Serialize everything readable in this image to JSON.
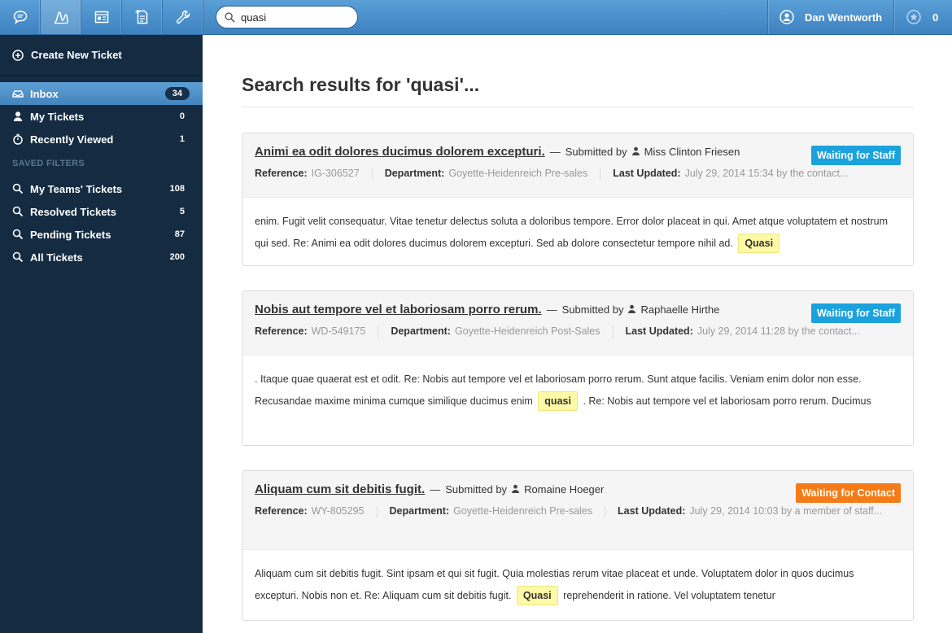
{
  "topbar": {
    "nav_icons": [
      "chat-icon",
      "stats-icon",
      "tickets-icon",
      "new-document-icon",
      "wrench-icon"
    ],
    "search_value": "quasi",
    "user_name": "Dan Wentworth",
    "star_count": "0"
  },
  "sidebar": {
    "create_label": "Create New Ticket",
    "items": [
      {
        "label": "Inbox",
        "count": "34",
        "icon": "inbox-icon"
      },
      {
        "label": "My Tickets",
        "count": "0",
        "icon": "user-icon"
      },
      {
        "label": "Recently Viewed",
        "count": "1",
        "icon": "stopwatch-icon"
      }
    ],
    "saved_filters_heading": "SAVED FILTERS",
    "filters": [
      {
        "label": "My Teams' Tickets",
        "count": "108"
      },
      {
        "label": "Resolved Tickets",
        "count": "5"
      },
      {
        "label": "Pending Tickets",
        "count": "87"
      },
      {
        "label": "All Tickets",
        "count": "200"
      }
    ]
  },
  "main": {
    "title": "Search results for 'quasi'...",
    "results": [
      {
        "title": "Animi ea odit dolores ducimus dolorem excepturi.",
        "submitted_by_label": "Submitted by",
        "submitter": "Miss Clinton Friesen",
        "status": "Waiting for Staff",
        "reference_label": "Reference:",
        "reference": "IG-306527",
        "department_label": "Department:",
        "department": "Goyette-Heidenreich Pre-sales",
        "updated_label": "Last Updated:",
        "updated": "July 29, 2014 15:34 by the contact...",
        "excerpt_before": "enim. Fugit velit consequatur. Vitae tenetur delectus soluta a doloribus tempore. Error dolor placeat in qui. Amet atque voluptatem et nostrum qui sed. Re: Animi ea odit dolores ducimus dolorem excepturi. Sed ab dolore consectetur tempore nihil ad.",
        "highlight": "Quasi",
        "excerpt_after": ""
      },
      {
        "title": "Nobis aut tempore vel et laboriosam porro rerum.",
        "submitted_by_label": "Submitted by",
        "submitter": "Raphaelle Hirthe",
        "status": "Waiting for Staff",
        "reference_label": "Reference:",
        "reference": "WD-549175",
        "department_label": "Department:",
        "department": "Goyette-Heidenreich Post-Sales",
        "updated_label": "Last Updated:",
        "updated": "July 29, 2014 11:28 by the contact...",
        "excerpt_before": ". Itaque quae quaerat est et odit. Re: Nobis aut tempore vel et laboriosam porro rerum. Sunt atque facilis. Veniam enim dolor non esse. Recusandae maxime minima cumque similique ducimus enim",
        "highlight": "quasi",
        "excerpt_after": ". Re: Nobis aut tempore vel et laboriosam porro rerum. Ducimus"
      },
      {
        "title": "Aliquam cum sit debitis fugit.",
        "submitted_by_label": "Submitted by",
        "submitter": "Romaine Hoeger",
        "status": "Waiting for Contact",
        "reference_label": "Reference:",
        "reference": "WY-805295",
        "department_label": "Department:",
        "department": "Goyette-Heidenreich Pre-sales",
        "updated_label": "Last Updated:",
        "updated": "July 29, 2014 10:03 by a member of staff...",
        "excerpt_before": "Aliquam cum sit debitis fugit. Sint ipsam et qui sit fugit. Quia molestias rerum vitae placeat et unde. Voluptatem dolor in quos ducimus excepturi. Nobis non et. Re: Aliquam cum sit debitis fugit.",
        "highlight": "Quasi",
        "excerpt_after": "reprehenderit in ratione. Vel voluptatem tenetur"
      }
    ]
  },
  "colors": {
    "topbar": "#4a90cc",
    "sidebar": "#142b42",
    "status_staff": "#1ba2dc",
    "status_contact": "#f47b17",
    "highlight": "#fdf9a6"
  }
}
